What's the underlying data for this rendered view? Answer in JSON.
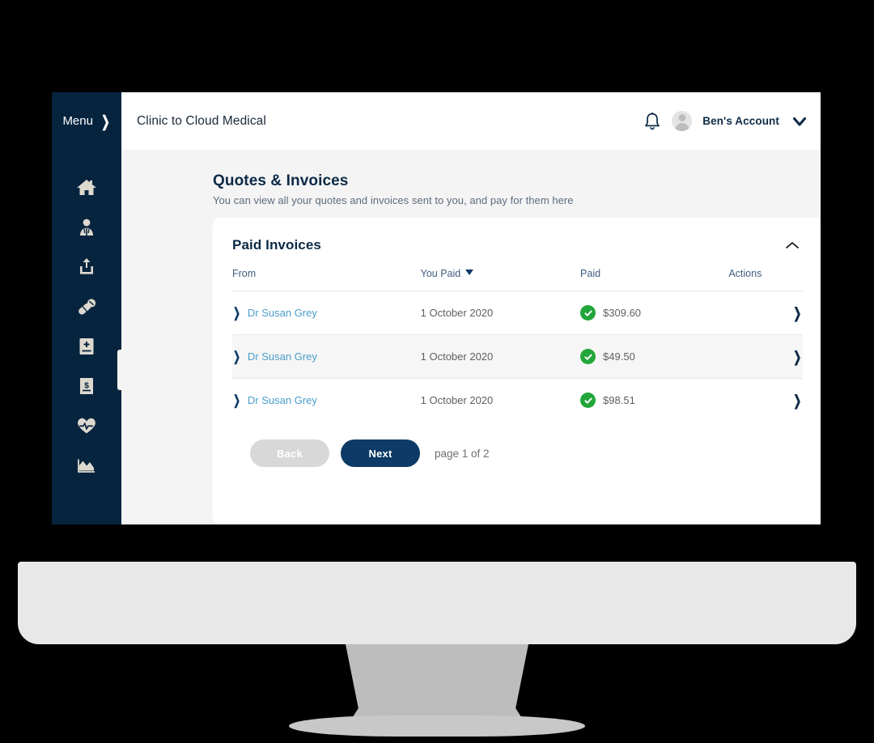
{
  "sidebar": {
    "menu_label": "Menu",
    "menu_chevron": "❯",
    "items": [
      {
        "name": "home",
        "icon": "home-icon"
      },
      {
        "name": "doctor",
        "icon": "doctor-icon"
      },
      {
        "name": "upload",
        "icon": "upload-icon"
      },
      {
        "name": "medication",
        "icon": "pills-icon"
      },
      {
        "name": "medical-record",
        "icon": "medical-record-icon"
      },
      {
        "name": "invoices",
        "icon": "invoice-dollar-icon",
        "active": true
      },
      {
        "name": "health",
        "icon": "heart-pulse-icon"
      },
      {
        "name": "reports",
        "icon": "chart-icon"
      }
    ]
  },
  "topbar": {
    "brand": "Clinic to Cloud Medical",
    "bell_icon": "bell-icon",
    "avatar_icon": "avatar-icon",
    "account_name": "Ben's Account",
    "account_chevron_icon": "chevron-down-icon"
  },
  "page": {
    "title": "Quotes & Invoices",
    "subtitle": "You can view all your quotes and invoices sent to you, and pay for them here"
  },
  "card": {
    "title": "Paid Invoices",
    "collapse_icon": "chevron-up-icon",
    "columns": {
      "from": "From",
      "you_paid": "You Paid",
      "paid": "Paid",
      "actions": "Actions"
    },
    "sorted_column": "You Paid",
    "sort_direction": "desc",
    "rows": [
      {
        "from": "Dr Susan Grey",
        "you_paid": "1 October 2020",
        "status_icon": "check-circle-icon",
        "paid": "$309.60",
        "action_icon": "chevron-right-icon"
      },
      {
        "from": "Dr Susan Grey",
        "you_paid": "1 October 2020",
        "status_icon": "check-circle-icon",
        "paid": "$49.50",
        "action_icon": "chevron-right-icon"
      },
      {
        "from": "Dr Susan Grey",
        "you_paid": "1 October 2020",
        "status_icon": "check-circle-icon",
        "paid": "$98.51",
        "action_icon": "chevron-right-icon"
      }
    ],
    "pagination": {
      "back_label": "Back",
      "next_label": "Next",
      "page_info": "page 1 of 2"
    }
  },
  "colors": {
    "sidebar_navy": "#07243f",
    "accent_navy": "#0d3a66",
    "link_blue": "#4a9ecb",
    "status_green": "#22a63b",
    "page_bg": "#f4f4f4",
    "disabled_grey": "#d8d8d8"
  }
}
